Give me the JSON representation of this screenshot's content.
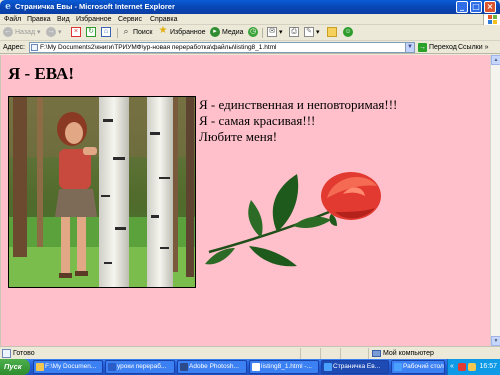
{
  "window": {
    "title": "Страничка Евы - Microsoft Internet Explorer",
    "minimize_symbol": "_",
    "maximize_symbol": "□",
    "close_symbol": "×"
  },
  "menu": {
    "items": [
      "Файл",
      "Правка",
      "Вид",
      "Избранное",
      "Сервис",
      "Справка"
    ]
  },
  "toolbar": {
    "back_label": "Назад",
    "forward_symbol": "→",
    "search_label": "Поиск",
    "favorites_label": "Избранное",
    "media_label": "Медиа"
  },
  "address": {
    "label": "Адрес:",
    "url": "F:\\My Documents2\\книги\\ТРИУМФ\\ур-новая переработка\\файлы\\listing8_1.html",
    "go_label": "Переход",
    "links_label": "Ссылки"
  },
  "page": {
    "heading": "Я - ЕВА!",
    "lines": [
      "Я - единственная и неповторимая!!!",
      "Я - самая красивая!!!",
      "Любите меня!"
    ]
  },
  "status": {
    "text": "Готово",
    "zone": "Мой компьютер"
  },
  "taskbar": {
    "start_label": "Пуск",
    "tasks": [
      {
        "label": "F:\\My Documen...",
        "icon_color": "#f3c750"
      },
      {
        "label": "уроки перераб...",
        "icon_color": "#2b5dc9"
      },
      {
        "label": "Adobe Photosh...",
        "icon_color": "#2d4b8a"
      },
      {
        "label": "listing8_1.html -...",
        "icon_color": "#ffffff"
      },
      {
        "label": "Страничка Ев...",
        "icon_color": "#4aa0ff"
      },
      {
        "label": "Рабочий стол",
        "icon_color": "#4aa0ff"
      }
    ],
    "clock": "16:57"
  },
  "colors": {
    "page_background": "#ffc0cb",
    "titlebar": "#0846b5",
    "taskbar": "#245edb",
    "start_button": "#2d8c2d"
  }
}
